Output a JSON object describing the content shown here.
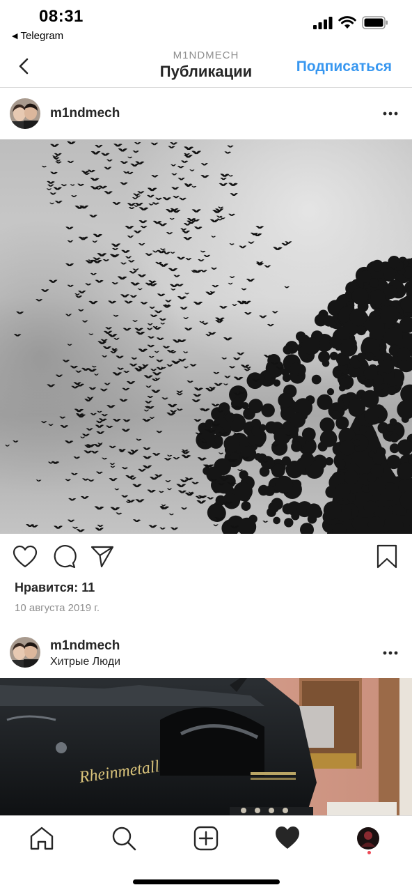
{
  "status_bar": {
    "time": "08:31",
    "back_app": "Telegram",
    "icons": [
      "signal-icon",
      "wifi-icon",
      "battery-icon"
    ]
  },
  "nav": {
    "subtitle": "M1NDMECH",
    "title": "Публикации",
    "follow_label": "Подписаться",
    "follow_color": "#3897f0"
  },
  "posts": [
    {
      "username": "m1ndmech",
      "location": "",
      "image": "birds-and-tree-photo",
      "likes": "Нравится: 11",
      "date": "10 августа 2019 г."
    },
    {
      "username": "m1ndmech",
      "location": "Хитрые Люди",
      "image": "typewriter-photo",
      "brand_text": "Rheinmetall"
    }
  ],
  "tabbar": {
    "items": [
      "home-icon",
      "search-icon",
      "new-post-icon",
      "activity-heart-icon",
      "profile-avatar"
    ],
    "notification_color": "#ed4956"
  }
}
